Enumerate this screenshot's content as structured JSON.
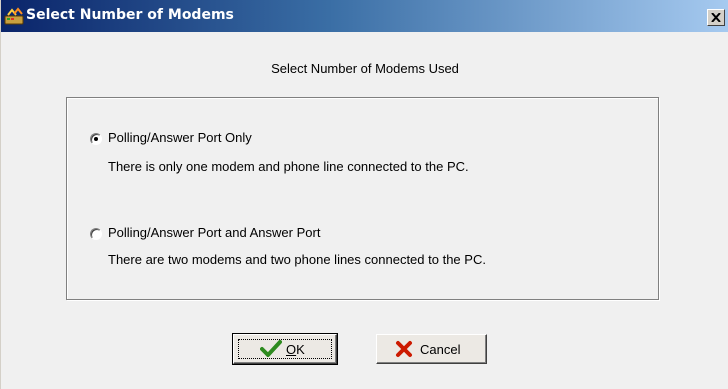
{
  "window": {
    "title": "Select Number of Modems",
    "close_icon": "close-x-icon",
    "app_icon": "modem-app-icon"
  },
  "dialog": {
    "heading": "Select Number of Modems Used",
    "options": [
      {
        "label": "Polling/Answer Port Only",
        "description": "There is only one modem and phone line connected to the PC.",
        "selected": true
      },
      {
        "label": "Polling/Answer Port and Answer Port",
        "description": "There are two modems and two phone lines connected to the PC.",
        "selected": false
      }
    ]
  },
  "buttons": {
    "ok": {
      "label_first": "O",
      "label_rest": "K",
      "icon": "checkmark-icon",
      "icon_color": "#2e8b1f"
    },
    "cancel": {
      "label": "Cancel",
      "icon": "red-x-icon",
      "icon_color": "#cc1a00"
    }
  },
  "colors": {
    "titlebar_start": "#0a246a",
    "titlebar_end": "#a6caf0",
    "dialog_bg": "#f0f0f0"
  }
}
